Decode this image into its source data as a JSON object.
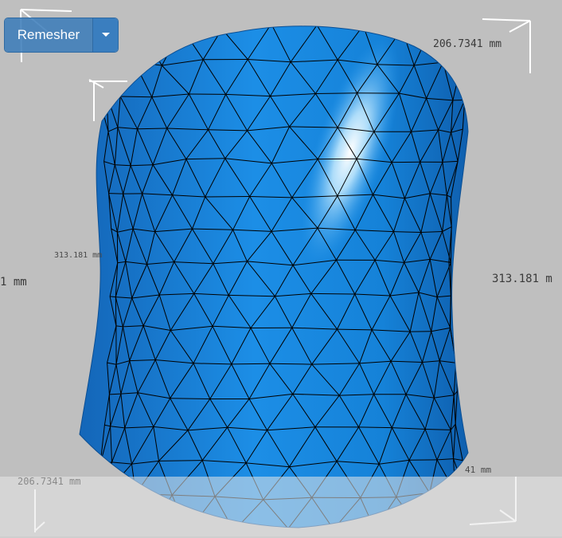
{
  "toolbar": {
    "remesher_label": "Remesher",
    "dropdown_icon": "caret-down-icon"
  },
  "dimensions": {
    "top_right": "206.7341 mm",
    "right": "313.181 m",
    "left_edge": "1 mm",
    "left_inner": "313.181 mm",
    "bottom_left": "206.7341 mm",
    "bottom_right": "41 mm"
  },
  "colors": {
    "background": "#bfbfbf",
    "mesh_fill": "#1a8ae0",
    "mesh_highlight": "#e8f6ff",
    "mesh_edges": "#000000",
    "bracket_lines": "#ffffff",
    "button": "#3a7ebf"
  }
}
